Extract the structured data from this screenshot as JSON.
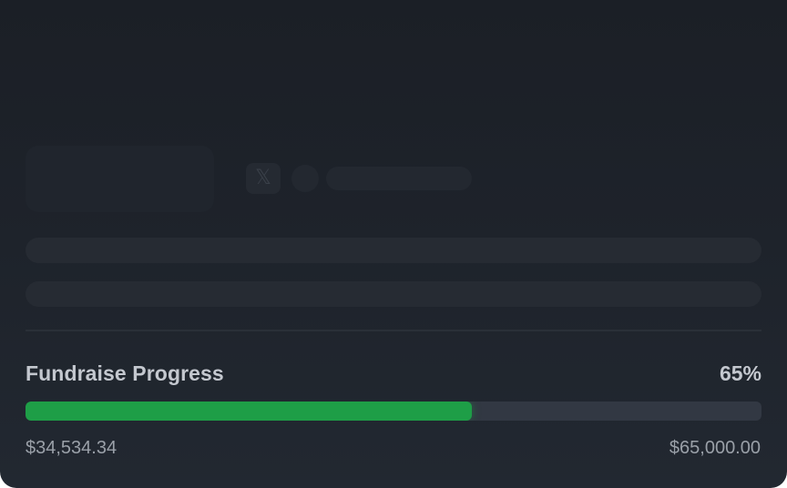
{
  "placeholders": {
    "x_icon": "𝕏"
  },
  "progress": {
    "title": "Fundraise Progress",
    "percent_label": "65%",
    "percent_value": 0.607,
    "raised": "$34,534.34",
    "goal": "$65,000.00"
  },
  "colors": {
    "fill": "#1e9e47",
    "track": "#323843",
    "background": "#1e232b"
  }
}
